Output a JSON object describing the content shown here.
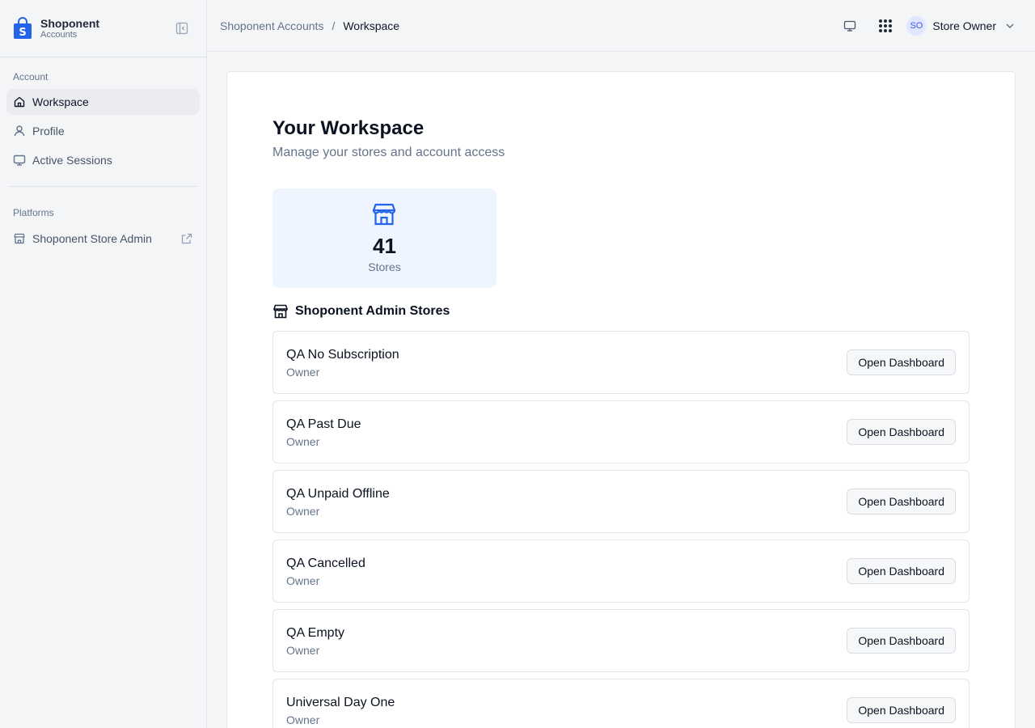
{
  "brand": {
    "name": "Shoponent",
    "sub": "Accounts"
  },
  "sidebar": {
    "account_label": "Account",
    "items": [
      {
        "label": "Workspace",
        "icon": "home-icon",
        "active": true
      },
      {
        "label": "Profile",
        "icon": "user-icon",
        "active": false
      },
      {
        "label": "Active Sessions",
        "icon": "monitor-icon",
        "active": false
      }
    ],
    "platforms_label": "Platforms",
    "platforms": [
      {
        "label": "Shoponent Store Admin",
        "icon": "store-icon",
        "external": true
      }
    ]
  },
  "header": {
    "breadcrumb_root": "Shoponent Accounts",
    "breadcrumb_sep": "/",
    "breadcrumb_current": "Workspace",
    "user_initials": "SO",
    "user_name": "Store Owner"
  },
  "main": {
    "title": "Your Workspace",
    "subtitle": "Manage your stores and account access",
    "stat": {
      "value": "41",
      "label": "Stores"
    },
    "stores_heading": "Shoponent Admin Stores",
    "open_label": "Open Dashboard",
    "stores": [
      {
        "name": "QA No Subscription",
        "role": "Owner"
      },
      {
        "name": "QA Past Due",
        "role": "Owner"
      },
      {
        "name": "QA Unpaid Offline",
        "role": "Owner"
      },
      {
        "name": "QA Cancelled",
        "role": "Owner"
      },
      {
        "name": "QA Empty",
        "role": "Owner"
      },
      {
        "name": "Universal Day One",
        "role": "Owner"
      }
    ]
  },
  "colors": {
    "accent": "#2563eb",
    "sidebar_bg": "#f4f5f7",
    "stat_bg": "#eef5ff"
  }
}
